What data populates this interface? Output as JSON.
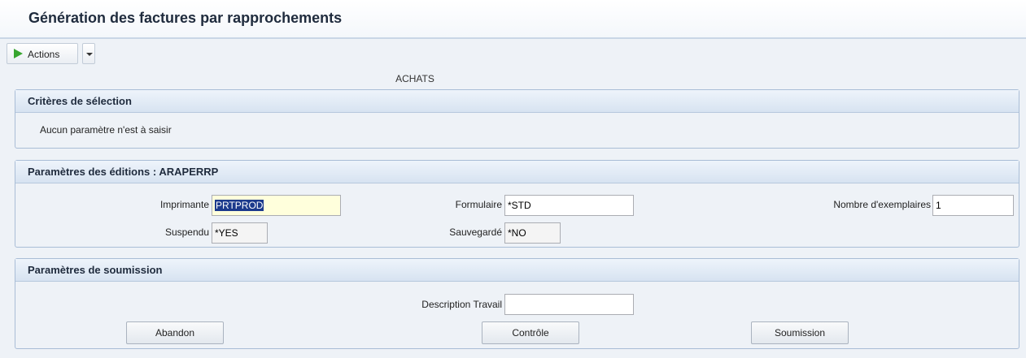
{
  "window": {
    "title": "Génération des factures par rapprochements"
  },
  "toolbar": {
    "actions_label": "Actions"
  },
  "module_label": "ACHATS",
  "criteria": {
    "title": "Critères de sélection",
    "message": "Aucun paramètre n'est à saisir"
  },
  "print_params": {
    "title": "Paramètres des éditions : ARAPERRP",
    "printer_label": "Imprimante",
    "printer_value": "PRTPROD",
    "form_label": "Formulaire",
    "form_value": "*STD",
    "copies_label": "Nombre d'exemplaires",
    "copies_value": "1",
    "hold_label": "Suspendu",
    "hold_value": "*YES",
    "save_label": "Sauvegardé",
    "save_value": "*NO"
  },
  "submit_params": {
    "title": "Paramètres de soumission",
    "job_desc_label": "Description Travail",
    "job_desc_value": "",
    "abandon_label": "Abandon",
    "control_label": "Contrôle",
    "submit_label": "Soumission"
  }
}
